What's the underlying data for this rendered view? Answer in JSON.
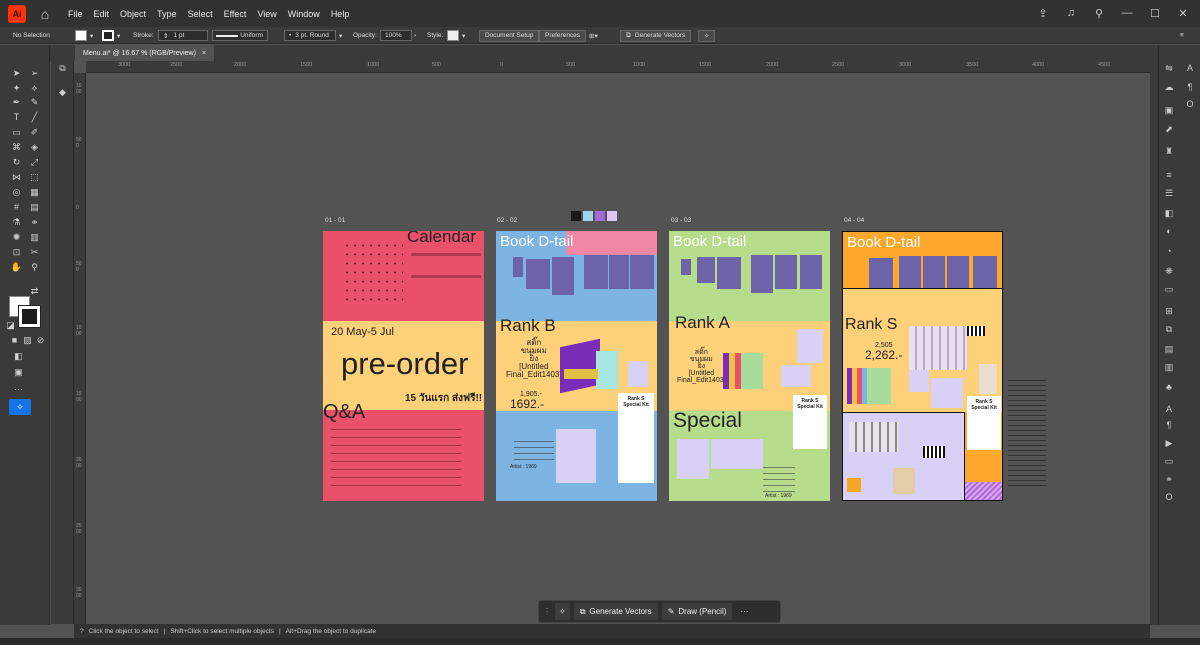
{
  "app": {
    "logo": "Ai",
    "menu": [
      "File",
      "Edit",
      "Object",
      "Type",
      "Select",
      "Effect",
      "View",
      "Window",
      "Help"
    ]
  },
  "control": {
    "selection": "No Selection",
    "stroke_label": "Stroke:",
    "stroke_value": "1 pt",
    "profile": "Uniform",
    "brush": "3 pt. Round",
    "opacity_label": "Opacity:",
    "opacity_value": "100%",
    "style_label": "Style:",
    "document_setup": "Document Setup",
    "preferences": "Preferences",
    "generate_vectors": "Generate Vectors"
  },
  "tab": {
    "title": "Menu.ai* @ 16.67 % (RGB/Preview)",
    "close": "×"
  },
  "ruler": {
    "h": [
      "3000",
      "2500",
      "2000",
      "1500",
      "1000",
      "500",
      "0",
      "500",
      "1000",
      "1500",
      "2000",
      "2500",
      "3000",
      "3500",
      "4000",
      "4500"
    ],
    "v": [
      "1000",
      "500",
      "0",
      "500",
      "1000",
      "1500",
      "2000",
      "2500",
      "3000"
    ]
  },
  "status": {
    "text1": "Click the object to select",
    "text2": "Shift+Click to select multiple objects",
    "text3": "Alt+Drag the object to duplicate"
  },
  "taskbar": {
    "generate": "Generate Vectors",
    "draw": "Draw (Pencil)",
    "more": "···"
  },
  "swatches": [
    "#1a1a1a",
    "#9fd4f0",
    "#a46ad8",
    "#d9c8f5"
  ],
  "artboards": [
    {
      "label": "01 - 01",
      "calendar": "Calendar",
      "date": "20 May-5 Jul",
      "preorder": "pre-order",
      "free": "15 วันแรก ส่งฟรี!!",
      "qa": "Q&A"
    },
    {
      "label": "02 - 02",
      "title": "Book D-tail",
      "rank": "Rank B",
      "note": "สติ๊ก\nขนุมผม\nยิ่ง\n[Untitled\nFinal_Edit1403]",
      "price_small": "1,905.-",
      "price": "1692.-",
      "kit": "Rank S\nSpecial Kit",
      "artist": "Artist : 1969"
    },
    {
      "label": "03 - 03",
      "title": "Book D-tail",
      "rank": "Rank A",
      "note": "สติ๊ก\nขนุมผม\nยิ่ง\n[Untitled\nFinal_Edit1403]",
      "special": "Special",
      "kit": "Rank S\nSpecial Kit",
      "artist": "Artist : 1969"
    },
    {
      "label": "04 - 04",
      "title": "Book D-tail",
      "rank": "Rank S",
      "price_small": "2,505",
      "price": "2,262.-",
      "kit": "Rank S\nSpecial Kit"
    }
  ]
}
